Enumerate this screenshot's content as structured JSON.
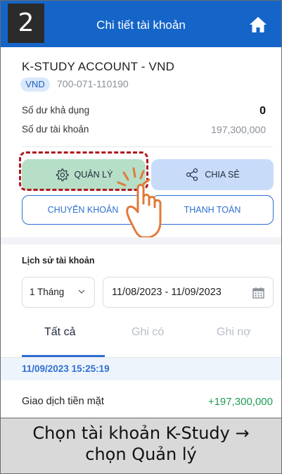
{
  "step_number": "2",
  "header": {
    "title": "Chi tiết tài khoản",
    "home_icon": "home-icon"
  },
  "account": {
    "name": "K-STUDY ACCOUNT - VND",
    "currency": "VND",
    "number": "700-071-110190",
    "available_label": "Số dư khả dụng",
    "available_value": "0",
    "balance_label": "Số dư tài khoản",
    "balance_value": "197,300,000"
  },
  "actions": {
    "manage": "QUẢN LÝ",
    "share": "CHIA SẺ",
    "transfer": "CHUYỂN KHOẢN",
    "pay": "THANH TOÁN"
  },
  "history": {
    "title": "Lịch sử tài khoản",
    "period": "1 Tháng",
    "date_range": "11/08/2023 - 11/09/2023",
    "tabs": [
      "Tất cả",
      "Ghi có",
      "Ghi nợ"
    ],
    "active_tab": "Tất cả",
    "group_date": "11/09/2023 15:25:19",
    "transactions": [
      {
        "label": "Giao dịch tiền mặt",
        "amount": "+197,300,000"
      }
    ]
  },
  "caption": {
    "line1": "Chọn tài khoản K-Study →",
    "line2": "chọn Quản lý"
  },
  "colors": {
    "header": "#1565c9",
    "manage_bg": "#b7dfc7",
    "share_bg": "#c8dcfa",
    "accent": "#2e6fd1",
    "credit": "#1f9d55",
    "highlight": "#b0181c",
    "hand": "#e07a3a"
  }
}
